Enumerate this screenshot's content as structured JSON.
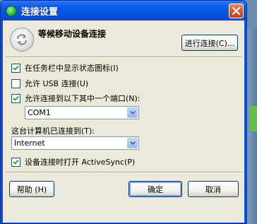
{
  "window": {
    "title": "连接设置"
  },
  "header": {
    "heading": "等候移动设备连接",
    "connect_button": "进行连接(C)..."
  },
  "options": {
    "show_tray_icon": {
      "label": "在任务栏中显示状态图标(I)",
      "checked": true
    },
    "allow_usb": {
      "label": "允许 USB 连接(U)",
      "checked": false
    },
    "allow_port": {
      "label": "允许连接到以下其中一个端口(N):",
      "checked": true
    },
    "port_value": "COM1",
    "computer_connected_label": "这台计算机已连接到(T):",
    "connection_value": "Internet",
    "open_activesync": {
      "label": "设备连接时打开 ActiveSync(P)",
      "checked": true
    }
  },
  "footer": {
    "help_button": "帮助 (H)",
    "ok_button": "确定",
    "cancel_button": "取消"
  },
  "colors": {
    "titlebar": "#0a52d8",
    "dialog_bg": "#ece9d8",
    "close_button": "#d8542c"
  }
}
